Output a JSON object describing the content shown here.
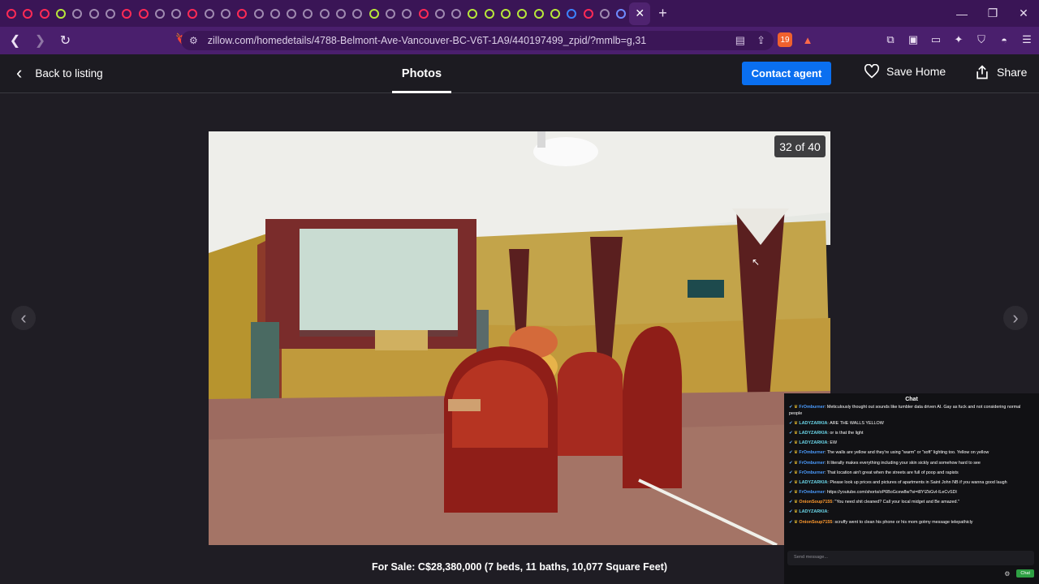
{
  "browser": {
    "url": "zillow.com/homedetails/4788-Belmont-Ave-Vancouver-BC-V6T-1A9/440197499_zpid/?mmlb=g,31",
    "brave_count": "19",
    "rewards_count": "1",
    "tab_colors": [
      "#ff2a55",
      "#ff2a55",
      "#ff2a55",
      "#b7e63a",
      "#9f8ab0",
      "#9f8ab0",
      "#9f8ab0",
      "#ff2a55",
      "#ff2a55",
      "#9f8ab0",
      "#9f8ab0",
      "#ff2a55",
      "#9f8ab0",
      "#9f8ab0",
      "#ff2a55",
      "#9f8ab0",
      "#9f8ab0",
      "#9f8ab0",
      "#9f8ab0",
      "#9f8ab0",
      "#9f8ab0",
      "#9f8ab0",
      "#b7e63a",
      "#9f8ab0",
      "#9f8ab0",
      "#ff2a55",
      "#9f8ab0",
      "#9f8ab0",
      "#b7e63a",
      "#b7e63a",
      "#b7e63a",
      "#b7e63a",
      "#b7e63a",
      "#b7e63a",
      "#3c84ff",
      "#ff2a55",
      "#9f8ab0",
      "#6f8cff"
    ]
  },
  "header": {
    "back_label": "Back to listing",
    "photos_label": "Photos",
    "contact_label": "Contact agent",
    "save_label": "Save Home",
    "share_label": "Share"
  },
  "gallery": {
    "counter": "32 of 40",
    "caption": "For Sale: C$28,380,000 (7 beds, 11 baths, 10,077 Square Feet)"
  },
  "chat": {
    "title": "Chat",
    "placeholder": "Send message...",
    "send_label": "Chat",
    "messages": [
      {
        "user": "FrOmburner",
        "cls": "u1",
        "text": ": Meticulously thought out sounds like tumbler data driven AI. Gay as fuck and not considering normal people"
      },
      {
        "user": "LADYZARKIA",
        "cls": "u2",
        "text": ": ARE THE WALLS YELLOW"
      },
      {
        "user": "LADYZARKIA",
        "cls": "u2",
        "text": ": or is that the light"
      },
      {
        "user": "LADYZARKIA",
        "cls": "u2",
        "text": ": EW"
      },
      {
        "user": "FrOmburner",
        "cls": "u1",
        "text": ": The walls are yellow and they're using \"warm\" or \"soft\" lighting too. Yellow on yellow"
      },
      {
        "user": "FrOmburner",
        "cls": "u1",
        "text": ": It literally makes everything including your skin sickly and somehow hard to see"
      },
      {
        "user": "FrOmburner",
        "cls": "u1",
        "text": ": That location ain't great when the streets are full of poop and rapists"
      },
      {
        "user": "LADYZARKIA",
        "cls": "u2",
        "text": ": Please look up prices and pictures of apartments in Saint John NB if you wanna good laugh"
      },
      {
        "user": "FrOmburner",
        "cls": "u1",
        "text": ": https://youtube.com/shorts/oP6BoGcew8w?si=t8YIZkGvI-lLeCvSDl"
      },
      {
        "user": "OnionSoup7155",
        "cls": "u3",
        "text": ": \"You need shit cleaned? Call your local midget and Be amazed.\""
      },
      {
        "user": "LADYZARKIA",
        "cls": "u2",
        "text": ":"
      },
      {
        "user": "OnionSoup7155",
        "cls": "u3",
        "text": ": scruffy went to clean his phone or his mom gotmy message telepathicly"
      }
    ]
  }
}
